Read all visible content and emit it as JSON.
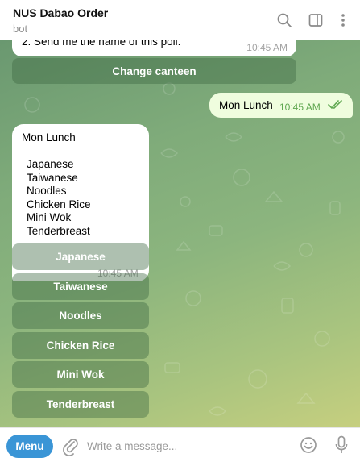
{
  "header": {
    "title": "NUS Dabao Order",
    "subtitle": "bot"
  },
  "chat": {
    "top_message": {
      "text": "2. Send me the name of this poll.",
      "time": "10:45 AM"
    },
    "change_canteen_button": "Change canteen",
    "outgoing": {
      "text": "Mon Lunch",
      "time": "10:45 AM",
      "status": "read"
    },
    "poll": {
      "title": "Mon Lunch",
      "options": [
        "Japanese",
        "Taiwanese",
        "Noodles",
        "Chicken Rice",
        "Mini Wok",
        "Tenderbreast"
      ],
      "time": "10:45 AM"
    },
    "keyboard_buttons": [
      "Japanese",
      "Taiwanese",
      "Noodles",
      "Chicken Rice",
      "Mini Wok",
      "Tenderbreast"
    ]
  },
  "input": {
    "menu_label": "Menu",
    "placeholder": "Write a message..."
  },
  "colors": {
    "accent": "#3a95d6",
    "outgoing_bubble": "#effdde",
    "read_check": "#5fa750"
  }
}
